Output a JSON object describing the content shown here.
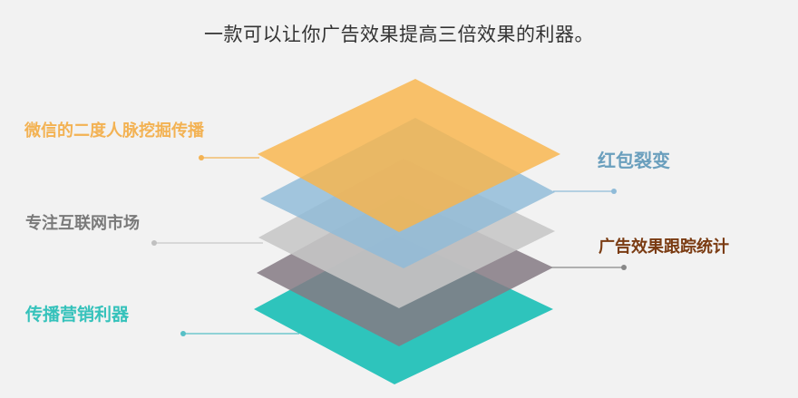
{
  "title": "一款可以让你广告效果提高三倍效果的利器。",
  "left_labels": {
    "wechat": "微信的二度人脉挖掘传播",
    "internet": "专注互联网市场",
    "marketing": "传播营销利器"
  },
  "right_labels": {
    "redpacket": "红包裂变",
    "tracking": "广告效果跟踪统计"
  },
  "colors": {
    "background": "#f2f2f2",
    "layer_orange": "#f9b54a",
    "layer_blue": "#8fbbd8",
    "layer_gray": "#c2c2c2",
    "layer_mauve": "#8a7f88",
    "layer_teal": "#2ec4bc"
  }
}
